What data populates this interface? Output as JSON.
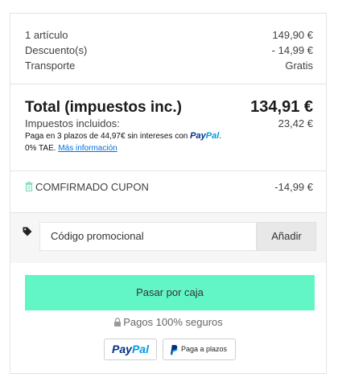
{
  "summary": {
    "rows": [
      {
        "label": "1 artículo",
        "value": "149,90 €"
      },
      {
        "label": "Descuento(s)",
        "value": "- 14,99 €"
      },
      {
        "label": "Transporte",
        "value": "Gratis"
      }
    ]
  },
  "totals": {
    "total_label": "Total (impuestos inc.)",
    "total_value": "134,91 €",
    "tax_label": "Impuestos incluidos:",
    "tax_value": "23,42 €",
    "paypal_message": {
      "text_before": "Paga en 3 plazos de 44,97€ sin intereses con ",
      "logo_pay": "Pay",
      "logo_pal": "Pal",
      "text_after": ".",
      "line2": "0% TAE. ",
      "link": "Más información"
    }
  },
  "coupon": {
    "icon": "trash-icon",
    "label": "COMFIRMADO CUPON",
    "value": "-14,99 €"
  },
  "promo": {
    "icon": "tag-icon",
    "placeholder": "Código promocional",
    "button": "Añadir"
  },
  "checkout": {
    "button": "Pasar por caja",
    "accent_color": "#62f5c5"
  },
  "secure": {
    "icon": "lock-icon",
    "text": "Pagos 100% seguros"
  },
  "payment_buttons": {
    "paypal_pay": "Pay",
    "paypal_pal": "Pal",
    "plazos": "Paga a plazos"
  }
}
